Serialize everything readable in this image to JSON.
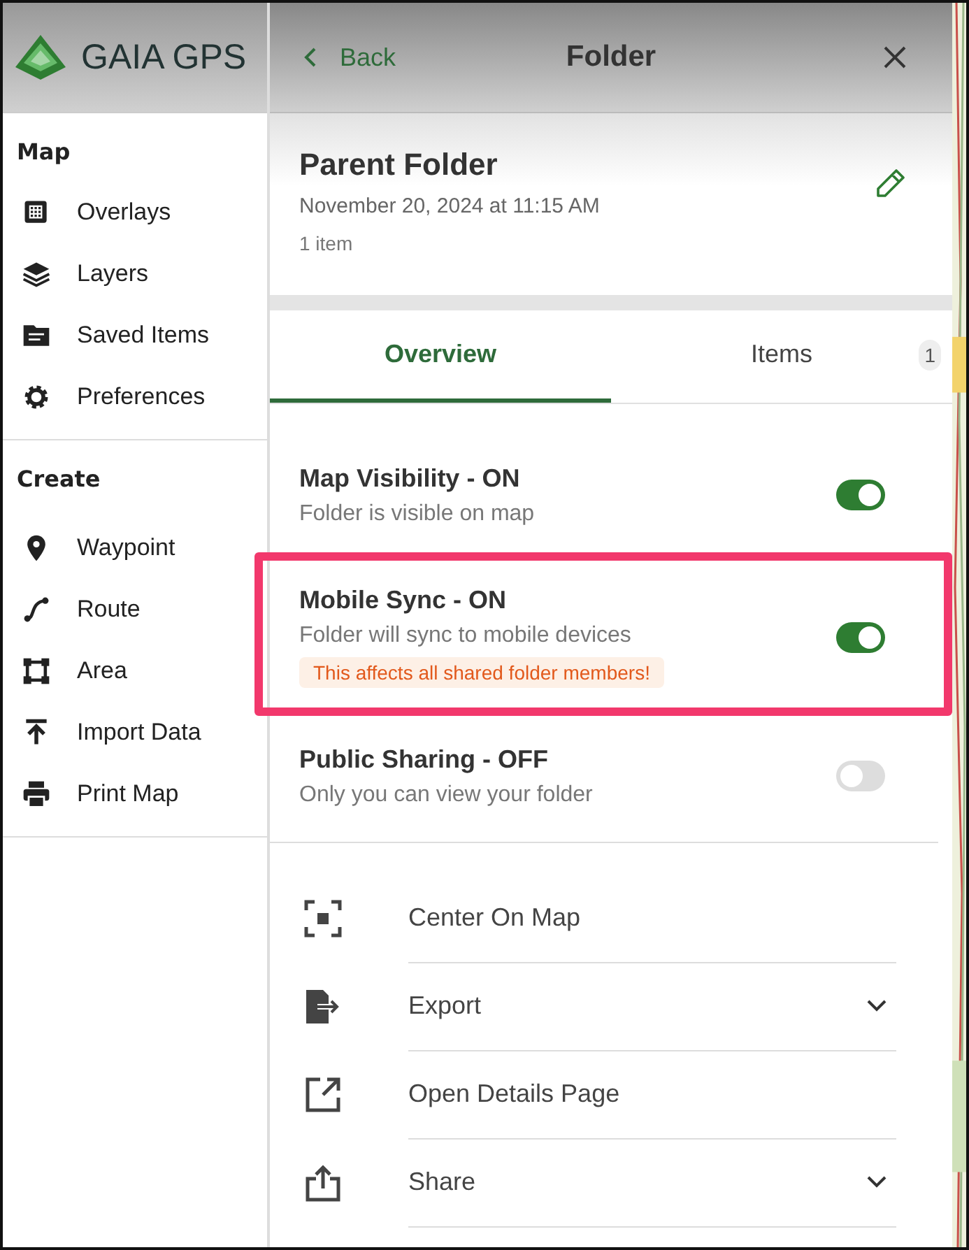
{
  "brand": {
    "name": "GAIA GPS"
  },
  "sidebar": {
    "sections": [
      {
        "title": "Map",
        "items": [
          {
            "label": "Overlays"
          },
          {
            "label": "Layers"
          },
          {
            "label": "Saved Items"
          },
          {
            "label": "Preferences"
          }
        ]
      },
      {
        "title": "Create",
        "items": [
          {
            "label": "Waypoint"
          },
          {
            "label": "Route"
          },
          {
            "label": "Area"
          },
          {
            "label": "Import Data"
          },
          {
            "label": "Print Map"
          }
        ]
      }
    ]
  },
  "header": {
    "back": "Back",
    "title": "Folder"
  },
  "folder": {
    "name": "Parent Folder",
    "date": "November 20, 2024 at 11:15 AM",
    "count": "1 item"
  },
  "tabs": [
    {
      "label": "Overview",
      "selected": true
    },
    {
      "label": "Items",
      "selected": false,
      "badge": "1"
    }
  ],
  "settings": [
    {
      "title": "Map Visibility - ON",
      "subtitle": "Folder is visible on map",
      "on": true,
      "highlighted": false
    },
    {
      "title": "Mobile Sync - ON",
      "subtitle": "Folder will sync to mobile devices",
      "warning": "This affects all shared folder members!",
      "on": true,
      "highlighted": true
    },
    {
      "title": "Public Sharing - OFF",
      "subtitle": "Only you can view your folder",
      "on": false,
      "highlighted": false
    }
  ],
  "actions": [
    {
      "label": "Center On Map",
      "expandable": false
    },
    {
      "label": "Export",
      "expandable": true
    },
    {
      "label": "Open Details Page",
      "expandable": false
    },
    {
      "label": "Share",
      "expandable": true
    }
  ]
}
